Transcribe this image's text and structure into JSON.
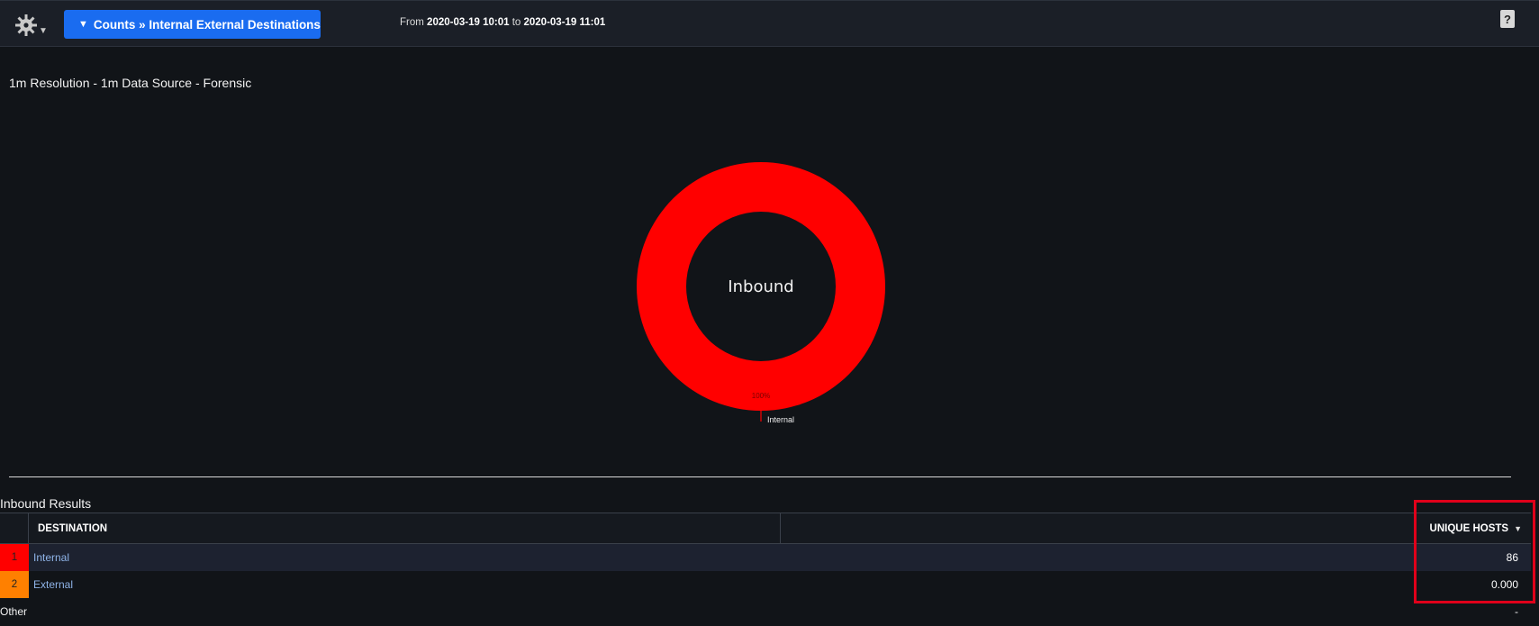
{
  "toolbar": {
    "menu_icon": "gear-icon",
    "breadcrumb_arrow": "▼",
    "breadcrumb_label": "Counts » Internal External Destinations",
    "time_from_prefix": "From",
    "time_from": "2020-03-19 10:01",
    "time_to_prefix": "to",
    "time_to": "2020-03-19 11:01",
    "help_label": "?"
  },
  "subtitle": "1m Resolution - 1m Data Source - Forensic",
  "chart_data": {
    "type": "pie",
    "center_label": "Inbound",
    "slices": [
      {
        "label": "Internal",
        "value": 100,
        "percent_label": "100%",
        "color": "#ff0000"
      }
    ]
  },
  "results": {
    "title": "Inbound Results",
    "columns": {
      "destination": "DESTINATION",
      "hosts": "UNIQUE HOSTS",
      "sort_indicator": "▼"
    },
    "rows": [
      {
        "rank": "1",
        "destination": "Internal",
        "hosts": "86",
        "color": "#ff0000"
      },
      {
        "rank": "2",
        "destination": "External",
        "hosts": "0.000",
        "color": "#ff8000"
      }
    ],
    "other": {
      "label": "Other",
      "value": "-"
    }
  },
  "colors": {
    "accent": "#1a6cf0",
    "highlight": "#e0001a",
    "background": "#111418"
  }
}
